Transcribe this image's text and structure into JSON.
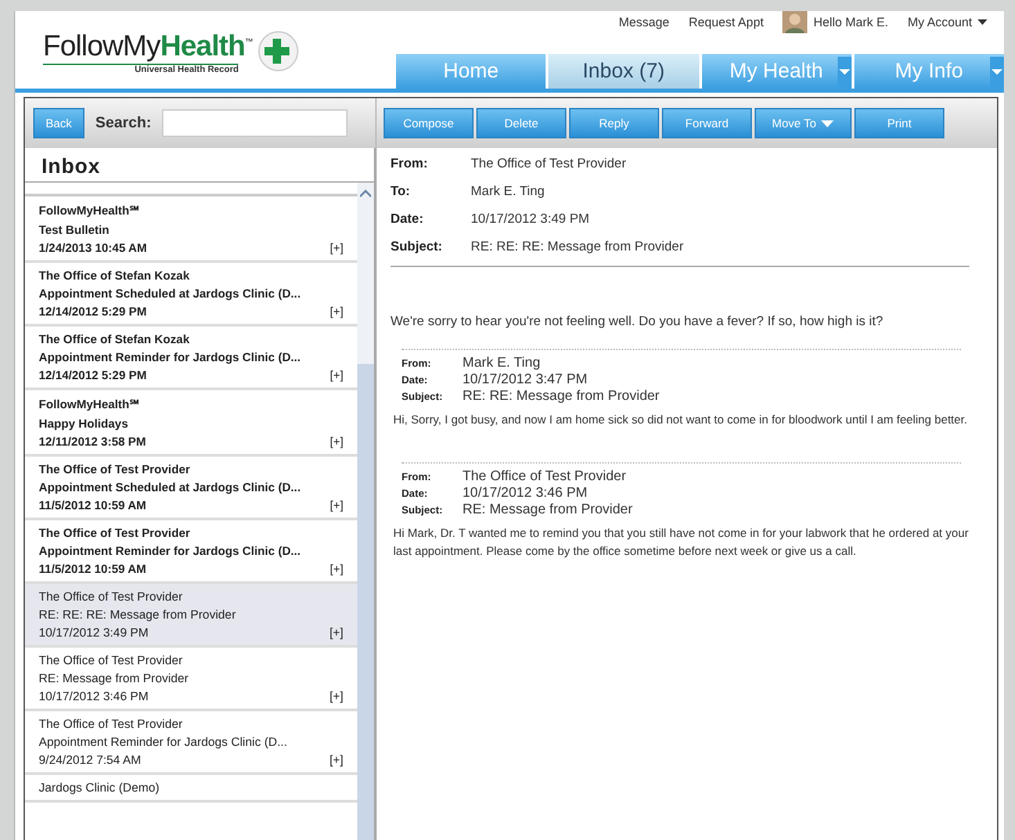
{
  "logo": {
    "brand_a": "FollowMy",
    "brand_b": "Health",
    "trademark": "™",
    "tagline": "Universal Health Record"
  },
  "top_links": [
    {
      "label": "Message",
      "kind": "link"
    },
    {
      "label": "Request Appt",
      "kind": "link"
    },
    {
      "label": "Hello Mark E.",
      "kind": "user"
    },
    {
      "label": "My Account",
      "kind": "menu"
    }
  ],
  "tabs": [
    {
      "label": "Home",
      "selected": false,
      "dropdown": false
    },
    {
      "label": "Inbox (7)",
      "selected": true,
      "dropdown": false
    },
    {
      "label": "My Health",
      "selected": false,
      "dropdown": true
    },
    {
      "label": "My Info",
      "selected": false,
      "dropdown": true
    }
  ],
  "left_toolbar": {
    "back": "Back",
    "search_label": "Search:"
  },
  "toolbar": [
    {
      "label": "Compose",
      "dropdown": false
    },
    {
      "label": "Delete",
      "dropdown": false
    },
    {
      "label": "Reply",
      "dropdown": false
    },
    {
      "label": "Forward",
      "dropdown": false
    },
    {
      "label": "Move To",
      "dropdown": true
    },
    {
      "label": "Print",
      "dropdown": false
    }
  ],
  "inbox": {
    "title": "Inbox",
    "messages": [
      {
        "sender": "FollowMyHealth℠",
        "subject": "Test Bulletin",
        "date": "1/24/2013 10:45 AM",
        "expand": "[+]",
        "unread": true,
        "selected": false
      },
      {
        "sender": "The Office of Stefan Kozak",
        "subject": "Appointment Scheduled at Jardogs Clinic (D...",
        "date": "12/14/2012 5:29 PM",
        "expand": "[+]",
        "unread": true,
        "selected": false
      },
      {
        "sender": "The Office of Stefan Kozak",
        "subject": "Appointment Reminder for Jardogs Clinic (D...",
        "date": "12/14/2012 5:29 PM",
        "expand": "[+]",
        "unread": true,
        "selected": false
      },
      {
        "sender": "FollowMyHealth℠",
        "subject": "Happy Holidays",
        "date": "12/11/2012 3:58 PM",
        "expand": "[+]",
        "unread": true,
        "selected": false
      },
      {
        "sender": "The Office of Test Provider",
        "subject": "Appointment Scheduled at Jardogs Clinic (D...",
        "date": "11/5/2012 10:59 AM",
        "expand": "[+]",
        "unread": true,
        "selected": false
      },
      {
        "sender": "The Office of Test Provider",
        "subject": "Appointment Reminder for Jardogs Clinic (D...",
        "date": "11/5/2012 10:59 AM",
        "expand": "[+]",
        "unread": true,
        "selected": false
      },
      {
        "sender": "The Office of Test Provider",
        "subject": "RE: RE: RE: Message from Provider",
        "date": "10/17/2012 3:49 PM",
        "expand": "[+]",
        "unread": false,
        "selected": true
      },
      {
        "sender": "The Office of Test Provider",
        "subject": "RE: Message from Provider",
        "date": "10/17/2012 3:46 PM",
        "expand": "[+]",
        "unread": false,
        "selected": false
      },
      {
        "sender": "The Office of Test Provider",
        "subject": "Appointment Reminder for Jardogs Clinic (D...",
        "date": "9/24/2012 7:54 AM",
        "expand": "[+]",
        "unread": false,
        "selected": false
      },
      {
        "sender": "Jardogs Clinic (Demo)",
        "unread": false,
        "selected": false
      }
    ]
  },
  "message": {
    "fields": [
      {
        "label": "From:",
        "value": "The Office of Test Provider"
      },
      {
        "label": "To:",
        "value": "Mark E. Ting"
      },
      {
        "label": "Date:",
        "value": "10/17/2012 3:49 PM"
      },
      {
        "label": "Subject:",
        "value": "RE: RE: RE: Message from Provider"
      }
    ],
    "body": "We're sorry to  hear you're not feeling well. Do you have a fever? If so, how high is it?",
    "quoted": [
      {
        "fields": [
          {
            "label": "From:",
            "value": "Mark E. Ting"
          },
          {
            "label": "Date:",
            "value": "10/17/2012 3:47 PM"
          },
          {
            "label": "Subject:",
            "value": "RE: RE: Message from Provider"
          }
        ],
        "body": "Hi, Sorry, I got busy, and now I am home sick so did not want to come in for bloodwork until I am feeling better."
      },
      {
        "fields": [
          {
            "label": "From:",
            "value": "The Office of Test Provider"
          },
          {
            "label": "Date:",
            "value": "10/17/2012 3:46 PM"
          },
          {
            "label": "Subject:",
            "value": "RE: Message from Provider"
          }
        ],
        "body": "Hi Mark, Dr. T wanted me to remind you that you still have not come in for your labwork that he ordered at your last appointment. Please come by the office sometime before next week or give us a call."
      }
    ]
  }
}
